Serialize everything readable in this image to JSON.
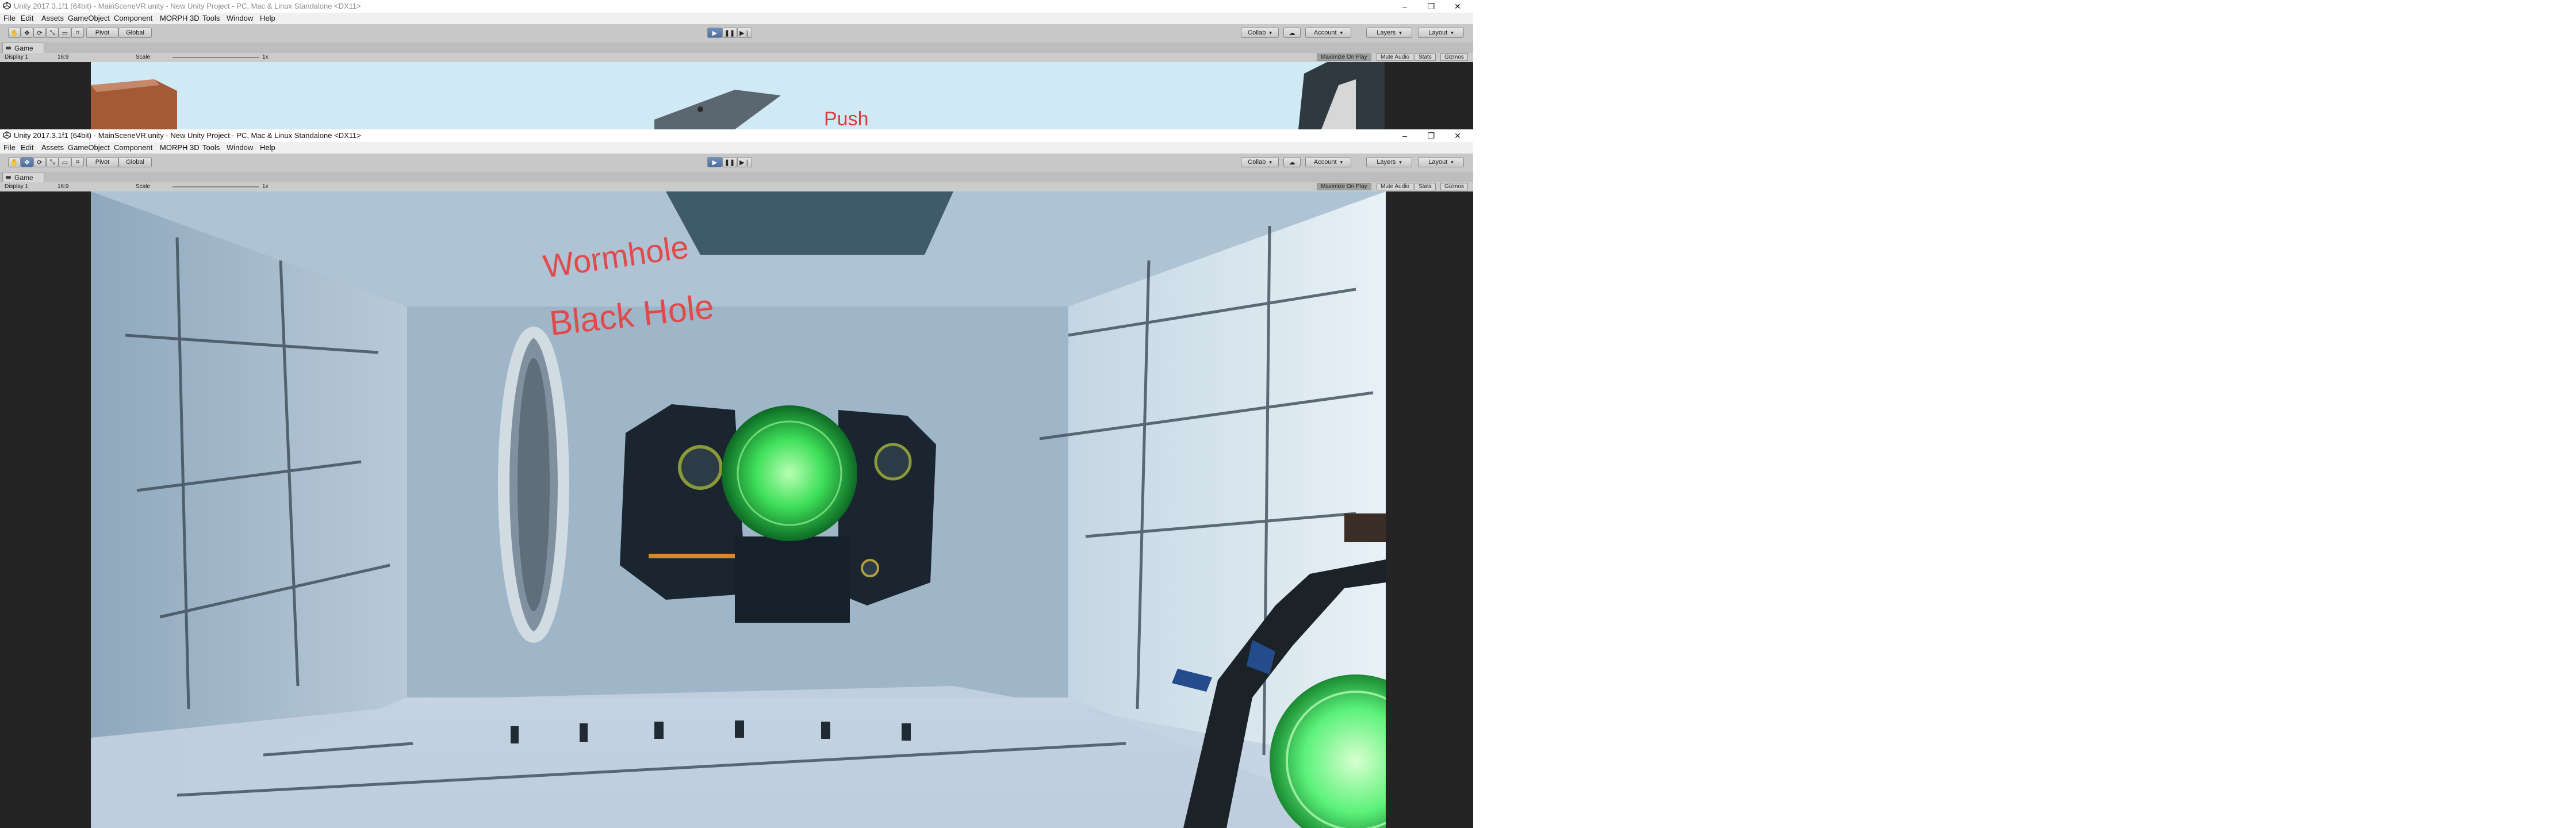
{
  "windows": [
    {
      "title": "Unity 2017.3.1f1 (64bit) - MainSceneVR.unity - New Unity Project - PC, Mac & Linux Standalone <DX11>",
      "menu": [
        "File",
        "Edit",
        "Assets",
        "GameObject",
        "Component",
        "MORPH 3D",
        "Tools",
        "Window",
        "Help"
      ],
      "toolbar": {
        "pivot": "Pivot",
        "global": "Global",
        "collab": "Collab",
        "account": "Account",
        "layers": "Layers",
        "layout": "Layout"
      },
      "game_tab": "Game",
      "game_bar": {
        "display": "Display 1",
        "aspect": "16:9",
        "scale_label": "Scale",
        "scale_value": "1x",
        "maximize": "Maximize On Play",
        "mute": "Mute Audio",
        "stats": "Stats",
        "gizmos": "Gizmos"
      },
      "scene_text": "Push"
    },
    {
      "title": "Unity 2017.3.1f1 (64bit) - MainSceneVR.unity - New Unity Project - PC, Mac & Linux Standalone <DX11>",
      "menu": [
        "File",
        "Edit",
        "Assets",
        "GameObject",
        "Component",
        "MORPH 3D",
        "Tools",
        "Window",
        "Help"
      ],
      "toolbar": {
        "pivot": "Pivot",
        "global": "Global",
        "collab": "Collab",
        "account": "Account",
        "layers": "Layers",
        "layout": "Layout"
      },
      "game_tab": "Game",
      "game_bar": {
        "display": "Display 1",
        "aspect": "16:9",
        "scale_label": "Scale",
        "scale_value": "1x",
        "maximize": "Maximize On Play",
        "mute": "Mute Audio",
        "stats": "Stats",
        "gizmos": "Gizmos"
      },
      "scene_text": [
        "Wormhole",
        "Black Hole"
      ]
    }
  ],
  "window_controls": {
    "minimize": "–",
    "restore": "❐",
    "close": "✕"
  },
  "colors": {
    "unity_bg": "#c2c2c2",
    "play_blue": "#4d6fa0",
    "sky": "#cfe9f5",
    "portal_green": "#3fe05a"
  }
}
